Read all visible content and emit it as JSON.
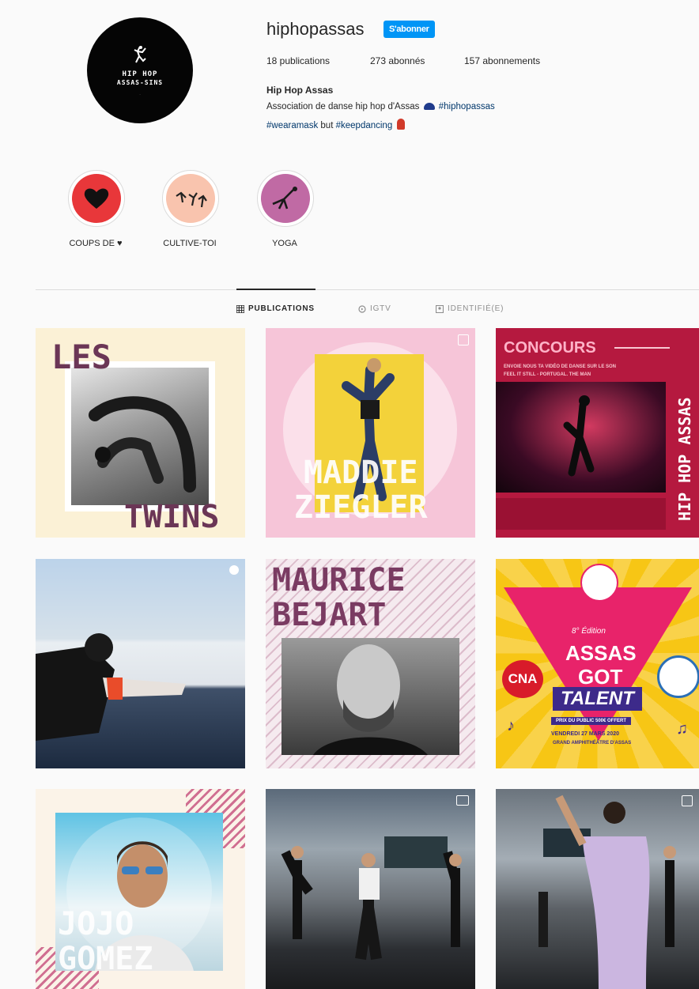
{
  "profile": {
    "username": "hiphopassas",
    "follow_label": "S'abonner",
    "avatar_text_1": "HIP HOP",
    "avatar_text_2": "ASSAS-SINS",
    "posts": "18 publications",
    "followers": "273 abonnés",
    "following": "157 abonnements",
    "full_name": "Hip Hop Assas",
    "bio_line1_prefix": "Association de danse hip hop d'Assas",
    "bio_line1_tag": "#hiphopassas",
    "bio_line2_tag1": "#wearamask",
    "bio_line2_mid": "but",
    "bio_line2_tag2": "#keepdancing"
  },
  "highlights": [
    {
      "label": "COUPS DE ♥",
      "color": "#e8373a",
      "icon": "heart-icon"
    },
    {
      "label": "CULTIVE-TOI",
      "color": "#f9c4ae",
      "icon": "dancers-icon"
    },
    {
      "label": "YOGA",
      "color": "#c06aa4",
      "icon": "yoga-icon"
    }
  ],
  "tabs": {
    "publications": "PUBLICATIONS",
    "igtv": "IGTV",
    "tagged": "IDENTIFIÉ(E)"
  },
  "posts": {
    "twins_1": "LES",
    "twins_2": "TWINS",
    "maddie_1": "MADDIE",
    "maddie_2": "ZIEGLER",
    "concours_title": "CONCOURS",
    "concours_sub1": "ENVOIE NOUS TA VIDÉO DE DANSE SUR LE SON",
    "concours_sub2": "FEEL IT STILL - PORTUGAL. THE MAN",
    "concours_side": "HIP HOP ASSAS",
    "maurice_1": "MAURICE",
    "maurice_2": "BEJART",
    "agt_edition": "8° Édition",
    "agt_1": "ASSAS",
    "agt_2": "GOT",
    "agt_3": "TALENT",
    "agt_cna": "CNA",
    "agt_prize": "PRIX DU PUBLIC 500€ OFFERT",
    "agt_date": "VENDREDI 27 MARS 2020",
    "agt_place": "GRAND AMPHITHÉÂTRE D'ASSAS",
    "jojo_1": "JOJO",
    "jojo_2": "GOMEZ"
  },
  "colors": {
    "accent_blue": "#0095f6",
    "twins_purple": "#6b3656",
    "concours_bg": "#b5193f",
    "agt_yellow": "#f7c615",
    "agt_pink": "#e8236a"
  }
}
